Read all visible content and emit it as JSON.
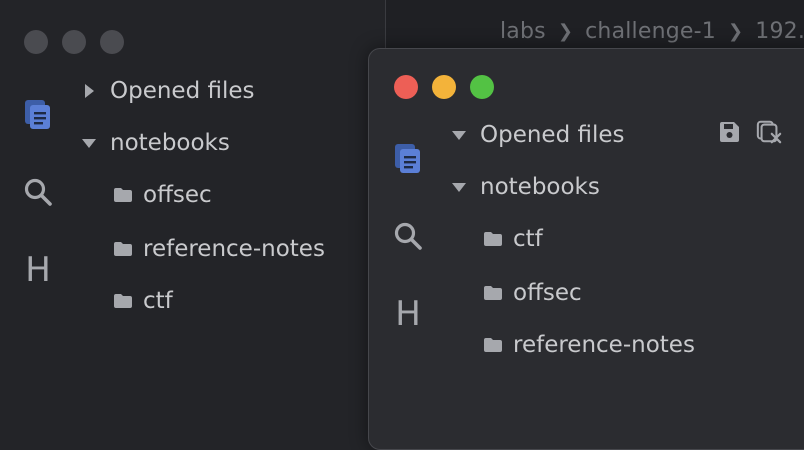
{
  "breadcrumb": [
    "labs",
    "challenge-1",
    "192."
  ],
  "back_window": {
    "tree": [
      {
        "label": "Opened files",
        "kind": "section",
        "expanded": false
      },
      {
        "label": "notebooks",
        "kind": "section",
        "expanded": true
      },
      {
        "label": "offsec",
        "kind": "folder"
      },
      {
        "label": "reference-notes",
        "kind": "folder"
      },
      {
        "label": "ctf",
        "kind": "folder"
      }
    ],
    "ribbon": {
      "heading_letter": "H"
    }
  },
  "front_window": {
    "tree": [
      {
        "label": "Opened files",
        "kind": "section",
        "expanded": true
      },
      {
        "label": "notebooks",
        "kind": "section",
        "expanded": true
      },
      {
        "label": "ctf",
        "kind": "folder"
      },
      {
        "label": "offsec",
        "kind": "folder"
      },
      {
        "label": "reference-notes",
        "kind": "folder"
      }
    ],
    "ribbon": {
      "heading_letter": "H"
    },
    "actions": [
      "save-icon",
      "close-all-icon"
    ]
  },
  "colors": {
    "accent": "#5b7fd6",
    "traffic_red": "#ed5f56",
    "traffic_yellow": "#f3b33a",
    "traffic_green": "#53c244"
  }
}
